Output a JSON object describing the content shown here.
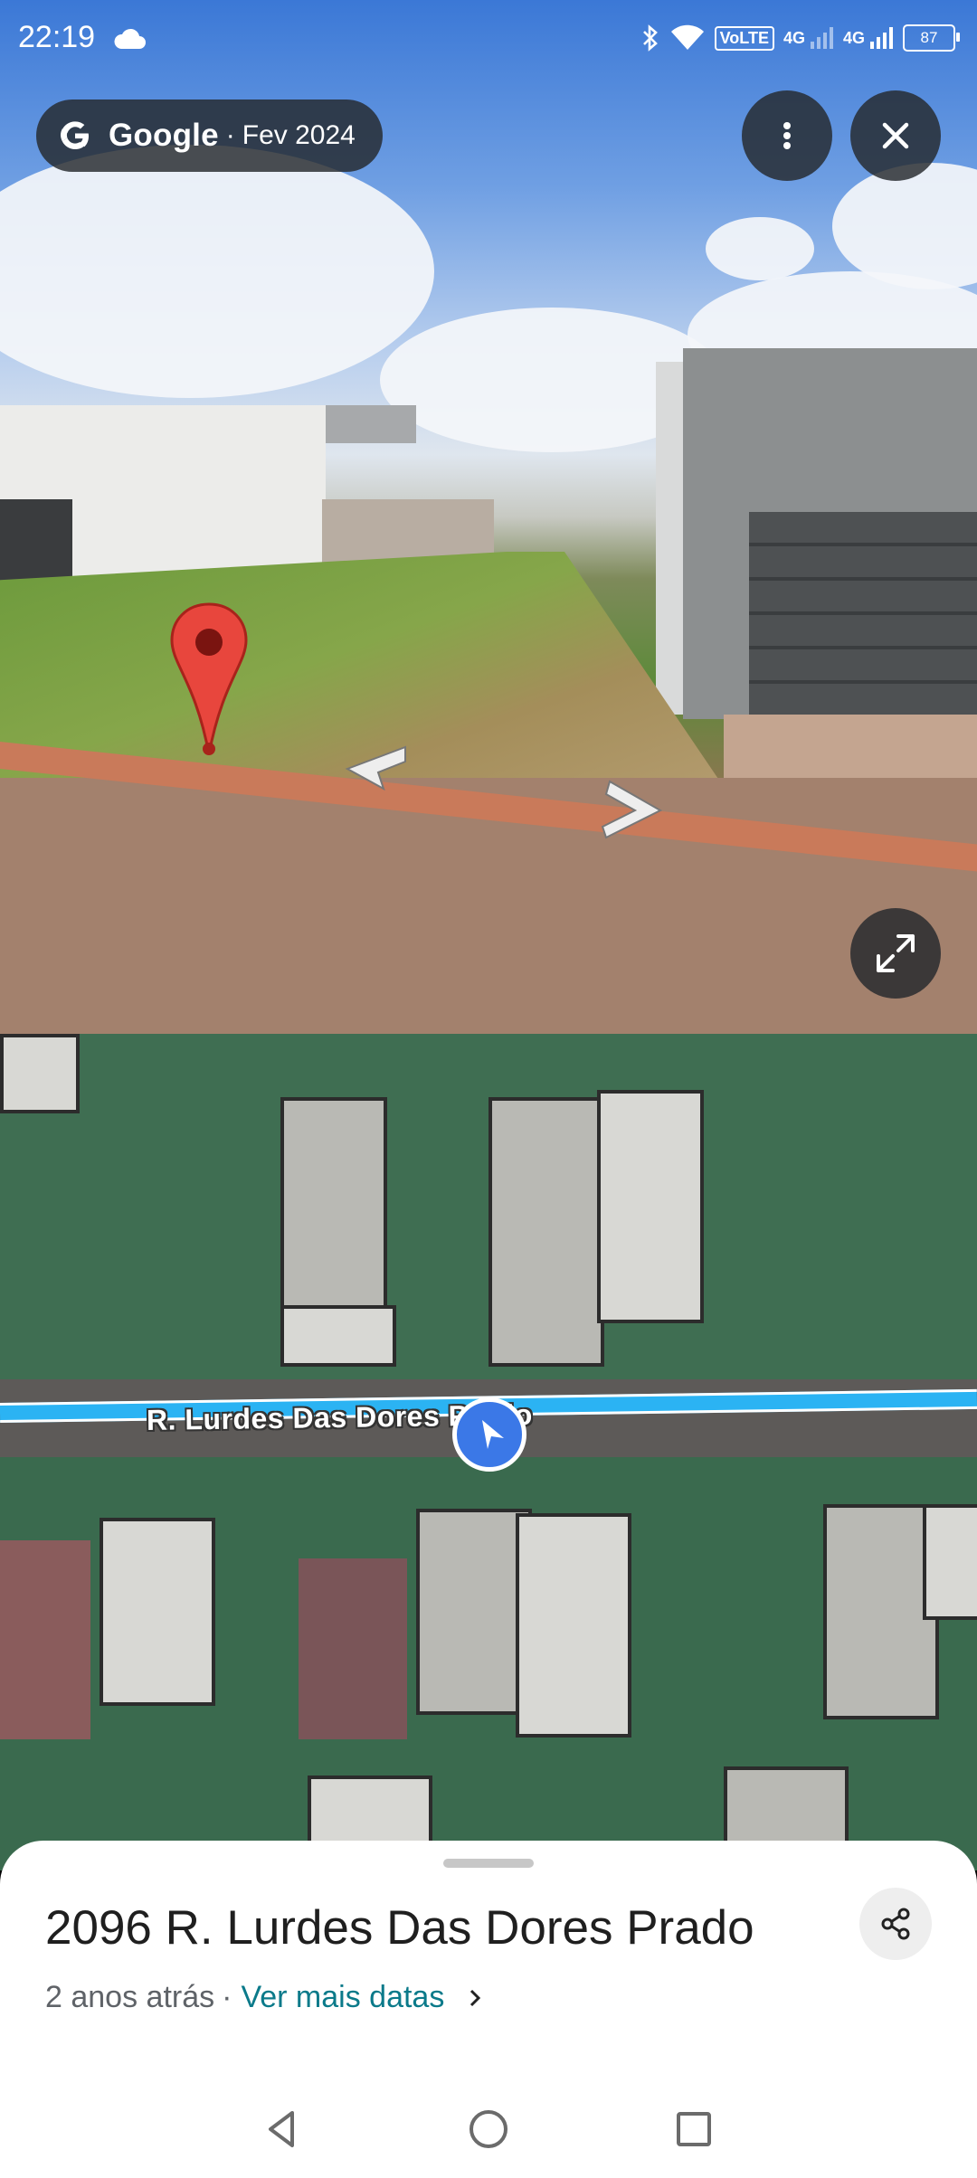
{
  "status_bar": {
    "time": "22:19",
    "battery": "87",
    "volte": "VoLTE",
    "net1": "4G",
    "net2": "4G"
  },
  "streetview_header": {
    "brand": "Google",
    "separator": "·",
    "date": "Fev 2024"
  },
  "map": {
    "street_label": "R. Lurdes Das Dores Prado"
  },
  "place": {
    "title": "2096 R. Lurdes Das Dores Prado",
    "age": "2 anos atrás",
    "separator": "·",
    "more_dates_link": "Ver mais datas"
  },
  "colors": {
    "accent_blue": "#3b78e7",
    "link_teal": "#0b7a8a",
    "route_blue": "#2bb3f3",
    "pin_red": "#e8463d"
  },
  "icons": {
    "menu": "more-vert-icon",
    "close": "close-icon",
    "expand": "expand-icon",
    "share": "share-icon",
    "pin": "map-pin-icon"
  }
}
